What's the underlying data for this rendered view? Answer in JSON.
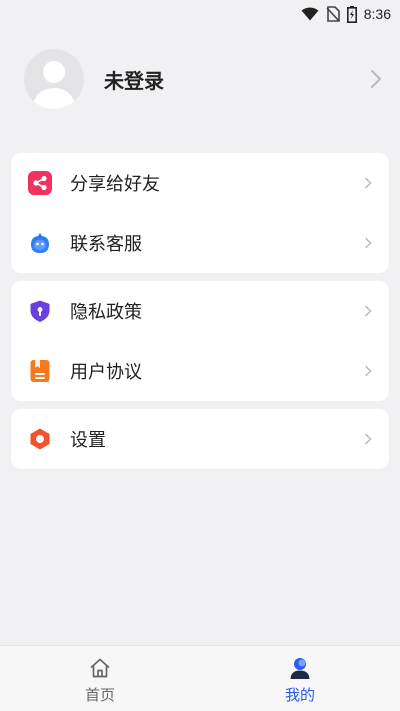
{
  "status_bar": {
    "time": "8:36"
  },
  "profile": {
    "name": "未登录"
  },
  "menu_groups": [
    {
      "items": [
        {
          "label": "分享给好友",
          "icon": "share-icon",
          "color": "#f0335e"
        },
        {
          "label": "联系客服",
          "icon": "customer-service-icon",
          "color": "#2f7cf6"
        }
      ]
    },
    {
      "items": [
        {
          "label": "隐私政策",
          "icon": "privacy-shield-icon",
          "color": "#6b3fd9"
        },
        {
          "label": "用户协议",
          "icon": "agreement-icon",
          "color": "#f7781f"
        }
      ]
    },
    {
      "items": [
        {
          "label": "设置",
          "icon": "settings-icon",
          "color": "#f2502f"
        }
      ]
    }
  ],
  "bottom_nav": {
    "items": [
      {
        "label": "首页",
        "icon": "home-icon",
        "active": false
      },
      {
        "label": "我的",
        "icon": "profile-icon",
        "active": true
      }
    ],
    "active_color": "#2a5ee8"
  }
}
